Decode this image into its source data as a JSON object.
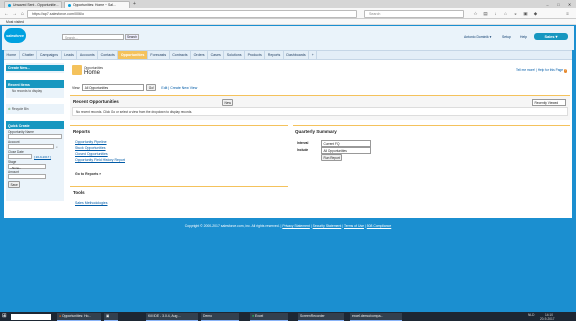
{
  "browser": {
    "tabs": [
      {
        "label": "Unsaved Sent - Opportunitie..."
      },
      {
        "label": "Opportunities: Home ~ Sal..."
      }
    ],
    "url": "https://ap7.salesforce.com/006/o",
    "search_placeholder": "Search",
    "bookmark": "Most visited"
  },
  "header": {
    "logo": "salesforce",
    "search_placeholder": "Search...",
    "search_button": "Search",
    "user_menu": "Antonio Dominik ▾",
    "setup": "Setup",
    "help": "Help",
    "app_menu": "Sales ▾"
  },
  "tabs": [
    {
      "label": "Home",
      "active": false
    },
    {
      "label": "Chatter",
      "active": false
    },
    {
      "label": "Campaigns",
      "active": false
    },
    {
      "label": "Leads",
      "active": false
    },
    {
      "label": "Accounts",
      "active": false
    },
    {
      "label": "Contacts",
      "active": false
    },
    {
      "label": "Opportunities",
      "active": true
    },
    {
      "label": "Forecasts",
      "active": false
    },
    {
      "label": "Contracts",
      "active": false
    },
    {
      "label": "Orders",
      "active": false
    },
    {
      "label": "Cases",
      "active": false
    },
    {
      "label": "Solutions",
      "active": false
    },
    {
      "label": "Products",
      "active": false
    },
    {
      "label": "Reports",
      "active": false
    },
    {
      "label": "Dashboards",
      "active": false
    },
    {
      "label": "+",
      "active": false
    }
  ],
  "sidebar": {
    "create_new": "Create New...",
    "recent_items_title": "Recent Items",
    "recent_items_empty": "No records to display",
    "recycle_bin": "Recycle Bin",
    "quick_create": {
      "title": "Quick Create",
      "name_label": "Opportunity Name",
      "account_label": "Account",
      "close_date_label": "Close Date",
      "close_date_hint": "[ 20-9-2017 ]",
      "stage_label": "Stage",
      "stage_value": "--None--",
      "amount_label": "Amount",
      "save_button": "Save"
    }
  },
  "main": {
    "breadcrumb": "Opportunities",
    "page_title": "Home",
    "tell_me_more": "Tell me more! | Help for this Page",
    "view_label": "View:",
    "view_value": "All Opportunities",
    "go_button": "Go!",
    "create_view": "Edit | Create New View",
    "recent_title": "Recent Opportunities",
    "new_button": "New",
    "recent_filter": "Recently Viewed",
    "recent_empty": "No recent records. Click Go or select a view from the dropdown to display records.",
    "reports_title": "Reports",
    "reports": [
      "Opportunity Pipeline",
      "Stuck Opportunities",
      "Closed Opportunities",
      "Opportunity Field History Report"
    ],
    "go_to_reports": "Go to Reports »",
    "quarterly_title": "Quarterly Summary",
    "interval_label": "Interval",
    "interval_value": "Current FQ",
    "include_label": "Include",
    "include_value": "All Opportunities",
    "run_report": "Run Report",
    "tools_title": "Tools",
    "tools": [
      "Sales Methodologies"
    ]
  },
  "footer": {
    "copyright": "Copyright © 2000-2017 salesforce.com, inc. All rights reserved. |",
    "links": [
      "Privacy Statement",
      "Security Statement",
      "Terms of Use",
      "508 Compliance"
    ]
  },
  "taskbar": {
    "items": [
      "",
      "Opportunities: Ho...",
      "",
      "Kill IDE - 3.0.4, Aug ...",
      "Demo",
      "Excel",
      "ScreenRecorder",
      "excel.demo/compa..."
    ],
    "lang": "NLD",
    "time": "14:10",
    "date": "20-9-2017"
  },
  "colors": {
    "brand": "#00a1e0",
    "page_bg": "#1b8fd0",
    "active_tab": "#f4c25c"
  }
}
